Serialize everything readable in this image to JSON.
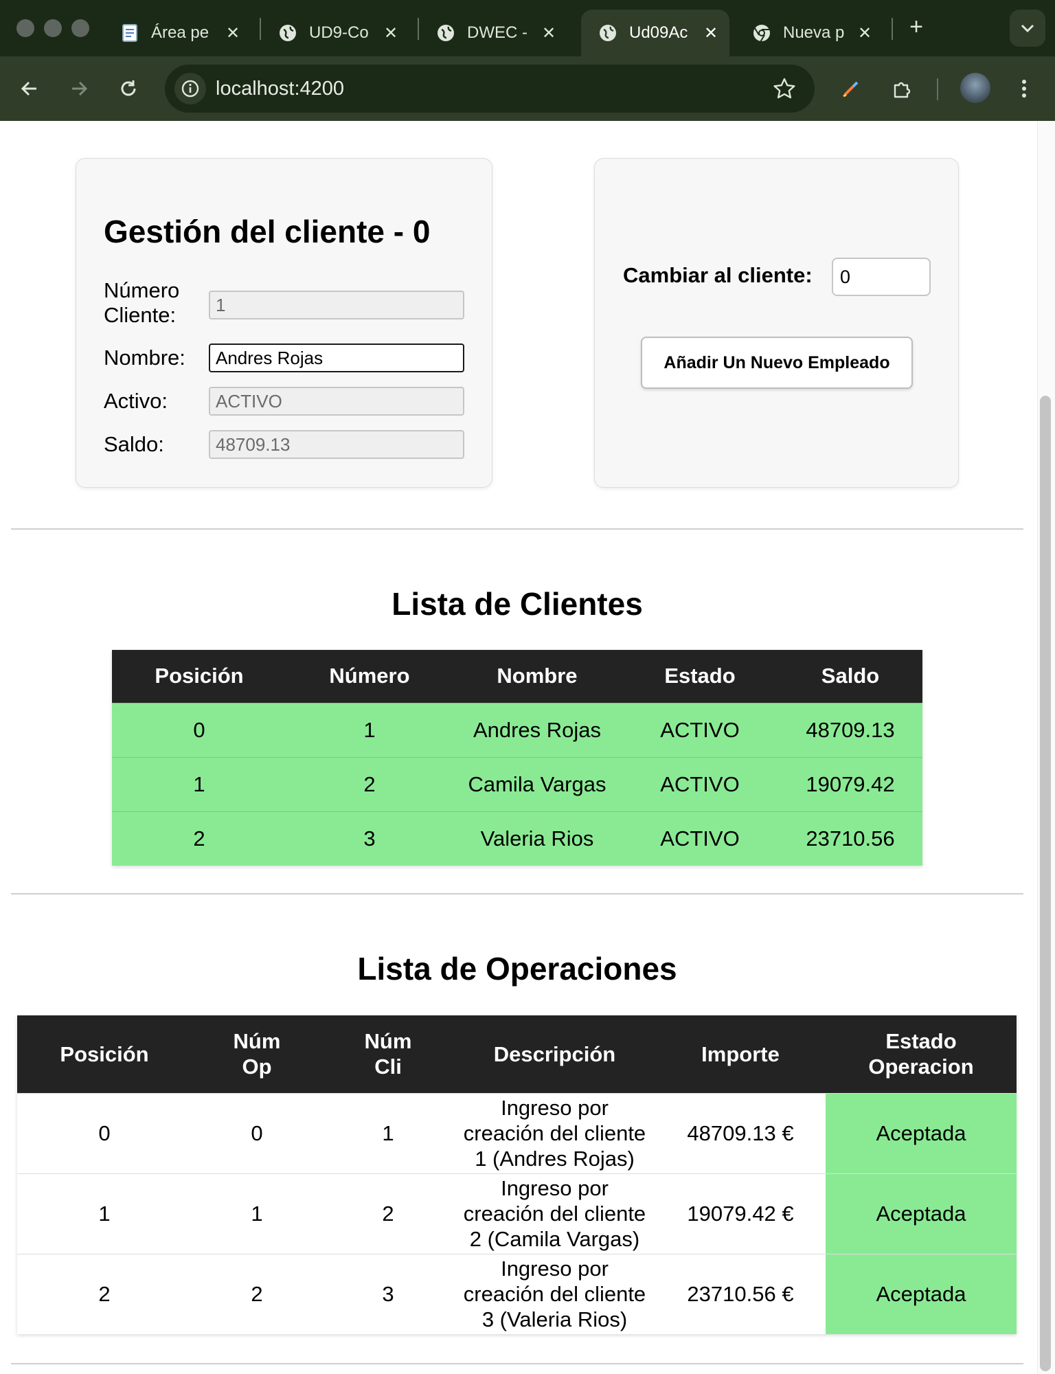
{
  "browser": {
    "tabs": [
      {
        "title": "Área pe",
        "icon": "document-icon"
      },
      {
        "title": "UD9-Co",
        "icon": "globe-icon"
      },
      {
        "title": "DWEC -",
        "icon": "globe-icon"
      },
      {
        "title": "Ud09Ac",
        "icon": "globe-icon",
        "active": true
      },
      {
        "title": "Nueva p",
        "icon": "chrome-icon"
      }
    ],
    "close_glyph": "✕",
    "new_tab_glyph": "+",
    "url": "localhost:4200"
  },
  "gestion": {
    "title": "Gestión del cliente - 0",
    "fields": {
      "numero": {
        "label": "Número Cliente:",
        "value": "1"
      },
      "nombre": {
        "label": "Nombre:",
        "value": "Andres Rojas"
      },
      "activo": {
        "label": "Activo:",
        "value": "ACTIVO"
      },
      "saldo": {
        "label": "Saldo:",
        "value": "48709.13"
      }
    }
  },
  "switcher": {
    "label": "Cambiar al cliente:",
    "value": "0",
    "add_button": "Añadir Un Nuevo Empleado"
  },
  "clientes": {
    "title": "Lista de Clientes",
    "headers": [
      "Posición",
      "Número",
      "Nombre",
      "Estado",
      "Saldo"
    ],
    "rows": [
      [
        "0",
        "1",
        "Andres Rojas",
        "ACTIVO",
        "48709.13"
      ],
      [
        "1",
        "2",
        "Camila Vargas",
        "ACTIVO",
        "19079.42"
      ],
      [
        "2",
        "3",
        "Valeria Rios",
        "ACTIVO",
        "23710.56"
      ]
    ]
  },
  "operaciones": {
    "title": "Lista de Operaciones",
    "headers": [
      "Posición",
      "Núm Op",
      "Núm Cli",
      "Descripción",
      "Importe",
      "Estado Operacion"
    ],
    "rows": [
      [
        "0",
        "0",
        "1",
        "Ingreso por creación del cliente 1 (Andres Rojas)",
        "48709.13 €",
        "Aceptada"
      ],
      [
        "1",
        "1",
        "2",
        "Ingreso por creación del cliente 2 (Camila Vargas)",
        "19079.42 €",
        "Aceptada"
      ],
      [
        "2",
        "2",
        "3",
        "Ingreso por creación del cliente 3 (Valeria Rios)",
        "23710.56 €",
        "Aceptada"
      ]
    ]
  },
  "colors": {
    "tab_bar": "#1b2a17",
    "toolbar": "#2f3d29",
    "row_green": "#8aea94",
    "table_header": "#232323"
  }
}
